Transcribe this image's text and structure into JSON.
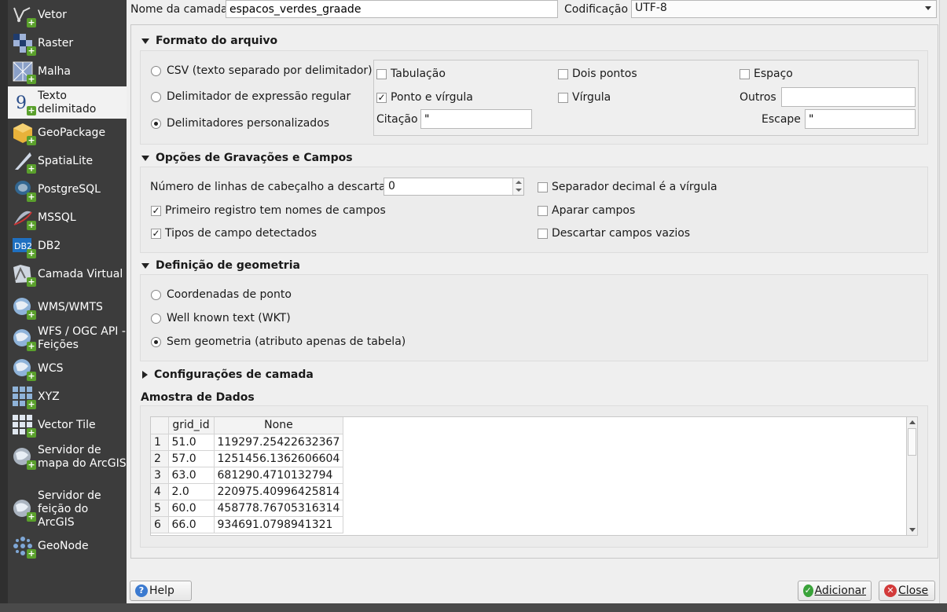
{
  "sidebar": {
    "items": [
      {
        "label": "Vetor",
        "icon": "vector-icon"
      },
      {
        "label": "Raster",
        "icon": "raster-icon"
      },
      {
        "label": "Malha",
        "icon": "mesh-icon"
      },
      {
        "label": "Texto\ndelimitado",
        "icon": "delimited-text-icon"
      },
      {
        "label": "GeoPackage",
        "icon": "geopackage-icon"
      },
      {
        "label": "SpatiaLite",
        "icon": "spatialite-icon"
      },
      {
        "label": "PostgreSQL",
        "icon": "postgresql-icon"
      },
      {
        "label": "MSSQL",
        "icon": "mssql-icon"
      },
      {
        "label": "DB2",
        "icon": "db2-icon"
      },
      {
        "label": "Camada Virtual",
        "icon": "virtual-layer-icon"
      },
      {
        "label": "WMS/WMTS",
        "icon": "wms-icon"
      },
      {
        "label": "WFS / OGC API -\nFeições",
        "icon": "wfs-icon"
      },
      {
        "label": "WCS",
        "icon": "wcs-icon"
      },
      {
        "label": "XYZ",
        "icon": "xyz-icon"
      },
      {
        "label": "Vector Tile",
        "icon": "vector-tile-icon"
      },
      {
        "label": "Servidor de\nmapa do ArcGIS",
        "icon": "arcgis-map-icon"
      },
      {
        "label": "Servidor de\nfeição do\nArcGIS",
        "icon": "arcgis-feature-icon"
      },
      {
        "label": "GeoNode",
        "icon": "geonode-icon"
      }
    ]
  },
  "top": {
    "layer_name_label": "Nome da camada",
    "layer_name_value": "espacos_verdes_graade",
    "encoding_label": "Codificação",
    "encoding_value": "UTF-8"
  },
  "file_format": {
    "title": "Formato do arquivo",
    "options": [
      "CSV (texto separado por delimitador)",
      "Delimitador de expressão regular",
      "Delimitadores personalizados"
    ],
    "selected_index": 2,
    "delims": {
      "tab": "Tabulação",
      "colon": "Dois pontos",
      "space": "Espaço",
      "semicolon": "Ponto e vírgula",
      "comma": "Vírgula",
      "others": "Outros",
      "quote_label": "Citação",
      "quote_value": "\"",
      "escape_label": "Escape",
      "escape_value": "\""
    }
  },
  "record_options": {
    "title": "Opções de Gravações e Campos",
    "skip_lines_label": "Número de linhas de cabeçalho a descartar",
    "skip_lines_value": "0",
    "first_record": "Primeiro registro tem nomes de campos",
    "detect_types": "Tipos de campo detectados",
    "decimal_comma": "Separador decimal é a vírgula",
    "trim_fields": "Aparar campos",
    "discard_empty": "Descartar campos vazios"
  },
  "geometry": {
    "title": "Definição de geometria",
    "options": [
      "Coordenadas de ponto",
      "Well known text (WKT)",
      "Sem geometria (atributo apenas de tabela)"
    ],
    "selected_index": 2
  },
  "layer_settings": {
    "title": "Configurações de camada"
  },
  "sample": {
    "title": "Amostra de Dados",
    "columns": [
      "grid_id",
      "None"
    ],
    "rows": [
      [
        "1",
        "51.0",
        "119297.25422632367"
      ],
      [
        "2",
        "57.0",
        "1251456.1362606604"
      ],
      [
        "3",
        "63.0",
        "681290.4710132794"
      ],
      [
        "4",
        "2.0",
        "220975.40996425814"
      ],
      [
        "5",
        "60.0",
        "458778.76705316314"
      ],
      [
        "6",
        "66.0",
        "934691.0798941321"
      ]
    ]
  },
  "buttons": {
    "help": "Help",
    "add": "Adicionar",
    "close": "Close"
  }
}
